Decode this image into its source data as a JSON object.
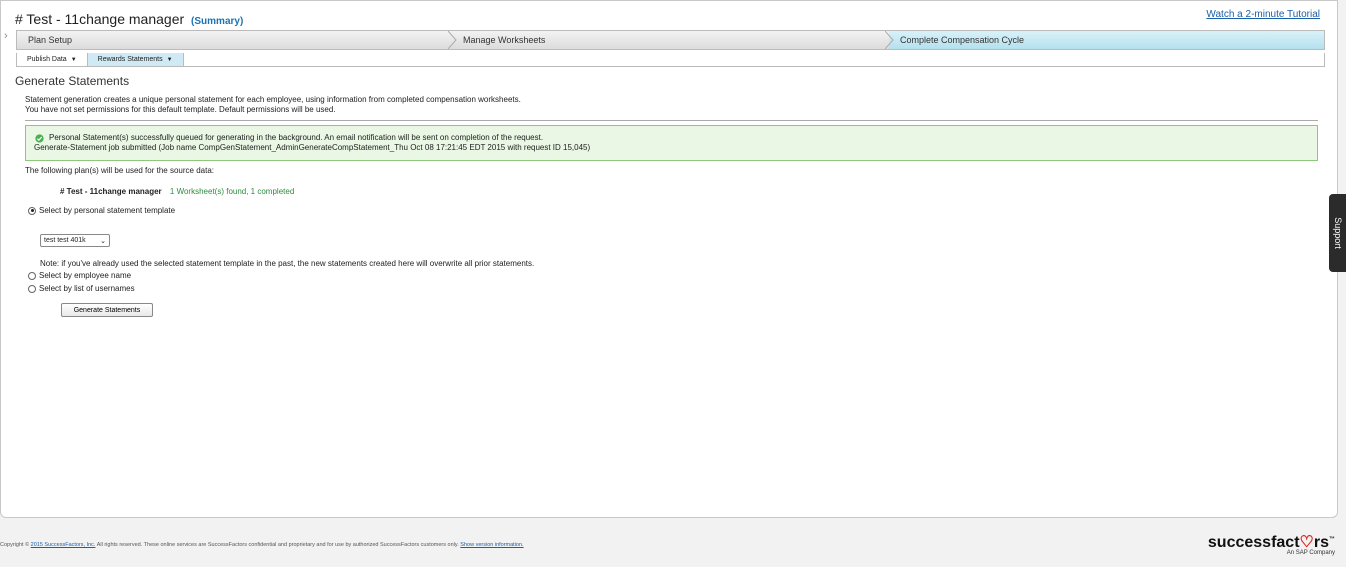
{
  "header": {
    "title": "# Test - 11change manager",
    "summary_label": "(Summary)",
    "tutorial_link": "Watch a 2-minute Tutorial"
  },
  "steps": [
    {
      "label": "Plan Setup"
    },
    {
      "label": "Manage Worksheets"
    },
    {
      "label": "Complete Compensation Cycle"
    }
  ],
  "subtabs": [
    {
      "label": "Publish Data"
    },
    {
      "label": "Rewards Statements"
    }
  ],
  "main": {
    "section_title": "Generate Statements",
    "desc_line1": "Statement generation creates a unique personal statement for each employee, using information from completed compensation worksheets.",
    "desc_line2": "You have not set permissions for this default template. Default permissions will be used.",
    "success_line1": "Personal Statement(s) successfully queued for generating in the background. An email notification will be sent on completion of the request.",
    "success_line2": "Generate-Statement job submitted (Job name CompGenStatement_AdminGenerateCompStatement_Thu Oct 08 17:21:45 EDT 2015 with request ID 15,045)",
    "plans_label": "The following plan(s) will be used for the source data:",
    "plan_name": "# Test - 11change manager",
    "plan_status": "1 Worksheet(s) found, 1 completed",
    "radio_template": "Select by personal statement template",
    "template_selected": "test test 401k",
    "note": "Note: if you've already used the selected statement template in the past, the new statements created here will overwrite all prior statements.",
    "radio_employee": "Select by employee name",
    "radio_usernames": "Select by list of usernames",
    "generate_button": "Generate Statements"
  },
  "support_label": "Support",
  "footer": {
    "copyright_prefix": "Copyright ©",
    "copyright_link": "2015 SuccessFactors, Inc.",
    "copyright_text": "All rights reserved. These online services are SuccessFactors confidential and proprietary and for use by authorized SuccessFactors customers only.",
    "version_link": "Show version information."
  },
  "logo": {
    "brand_part1": "successfact",
    "brand_heart": "♡",
    "brand_part2": "rs",
    "tm": "™",
    "sub": "An SAP Company"
  },
  "colors": {
    "active_step": "#b4e1ef",
    "success_bg": "#e9f7e4",
    "success_border": "#8fc77a",
    "link": "#1a5fa8",
    "logo_accent": "#e2231a"
  }
}
